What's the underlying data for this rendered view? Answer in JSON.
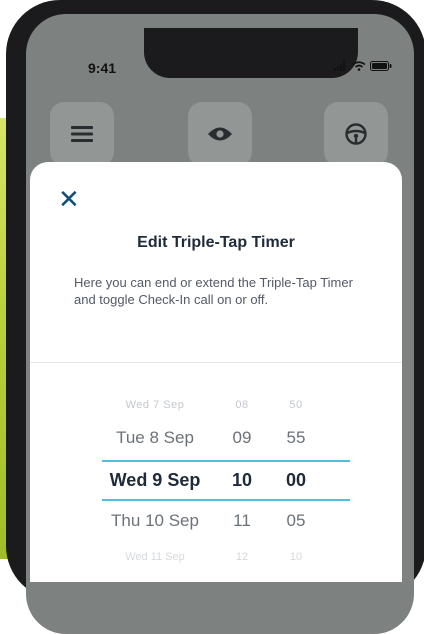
{
  "status_bar": {
    "time": "9:41"
  },
  "top_icons": [
    "menu-icon",
    "eye-icon",
    "steering-wheel-icon"
  ],
  "modal": {
    "close_label": "✕",
    "title": "Edit Triple-Tap Timer",
    "description": "Here you can end or extend the Triple-Tap Timer and toggle Check-In call on or off."
  },
  "picker": {
    "rows": [
      {
        "date": "Wed 7 Sep",
        "hour": "08",
        "minute": "50"
      },
      {
        "date": "Tue 8 Sep",
        "hour": "09",
        "minute": "55"
      },
      {
        "date": "Wed 9 Sep",
        "hour": "10",
        "minute": "00"
      },
      {
        "date": "Thu 10 Sep",
        "hour": "11",
        "minute": "05"
      },
      {
        "date": "Wed 11 Sep",
        "hour": "12",
        "minute": "10"
      }
    ],
    "selected_index": 2
  },
  "colors": {
    "accent_line": "#4fbfe0",
    "close_icon": "#0e4e78",
    "brand_green": "#b9cf3c"
  }
}
